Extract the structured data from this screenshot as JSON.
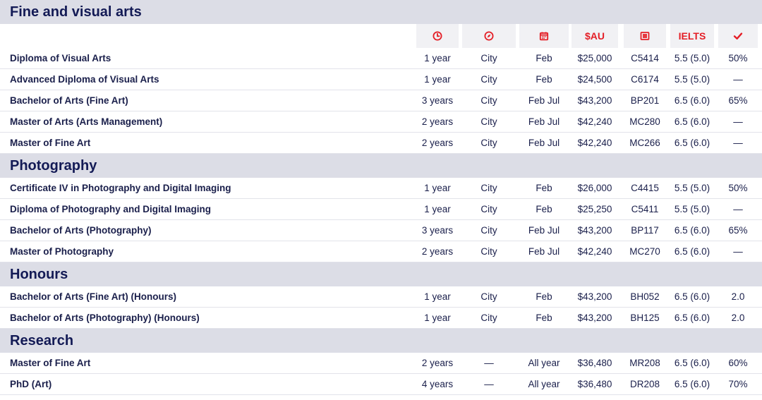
{
  "header_icons": [
    "clock-icon",
    "compass-icon",
    "calendar-icon",
    "$AU",
    "list-icon",
    "IELTS",
    "checkmark-icon"
  ],
  "header_labels": {
    "fee": "$AU",
    "ielts": "IELTS"
  },
  "colors": {
    "accent": "#e41e26",
    "section_bg": "#dcdde6",
    "text": "#1a1f4b"
  },
  "sections": [
    {
      "title": "Fine and visual arts",
      "rows": [
        [
          "Diploma of Visual Arts",
          "1 year",
          "City",
          "Feb",
          "$25,000",
          "C5414",
          "5.5 (5.0)",
          "50%"
        ],
        [
          "Advanced Diploma of Visual Arts",
          "1 year",
          "City",
          "Feb",
          "$24,500",
          "C6174",
          "5.5 (5.0)",
          "—"
        ],
        [
          "Bachelor of Arts (Fine Art)",
          "3 years",
          "City",
          "Feb Jul",
          "$43,200",
          "BP201",
          "6.5 (6.0)",
          "65%"
        ],
        [
          "Master of Arts (Arts Management)",
          "2 years",
          "City",
          "Feb Jul",
          "$42,240",
          "MC280",
          "6.5 (6.0)",
          "—"
        ],
        [
          "Master of Fine Art",
          "2 years",
          "City",
          "Feb Jul",
          "$42,240",
          "MC266",
          "6.5 (6.0)",
          "—"
        ]
      ]
    },
    {
      "title": "Photography",
      "rows": [
        [
          "Certificate IV in Photography and Digital Imaging",
          "1 year",
          "City",
          "Feb",
          "$26,000",
          "C4415",
          "5.5 (5.0)",
          "50%"
        ],
        [
          "Diploma of Photography and Digital Imaging",
          "1 year",
          "City",
          "Feb",
          "$25,250",
          "C5411",
          "5.5 (5.0)",
          "—"
        ],
        [
          "Bachelor of Arts (Photography)",
          "3 years",
          "City",
          "Feb Jul",
          "$43,200",
          "BP117",
          "6.5 (6.0)",
          "65%"
        ],
        [
          "Master of Photography",
          "2 years",
          "City",
          "Feb Jul",
          "$42,240",
          "MC270",
          "6.5 (6.0)",
          "—"
        ]
      ]
    },
    {
      "title": "Honours",
      "rows": [
        [
          "Bachelor of Arts (Fine Art) (Honours)",
          "1 year",
          "City",
          "Feb",
          "$43,200",
          "BH052",
          "6.5 (6.0)",
          "2.0"
        ],
        [
          "Bachelor of Arts (Photography) (Honours)",
          "1 year",
          "City",
          "Feb",
          "$43,200",
          "BH125",
          "6.5 (6.0)",
          "2.0"
        ]
      ]
    },
    {
      "title": "Research",
      "rows": [
        [
          "Master of Fine Art",
          "2 years",
          "—",
          "All year",
          "$36,480",
          "MR208",
          "6.5 (6.0)",
          "60%"
        ],
        [
          "PhD (Art)",
          "4 years",
          "—",
          "All year",
          "$36,480",
          "DR208",
          "6.5 (6.0)",
          "70%"
        ]
      ]
    }
  ]
}
